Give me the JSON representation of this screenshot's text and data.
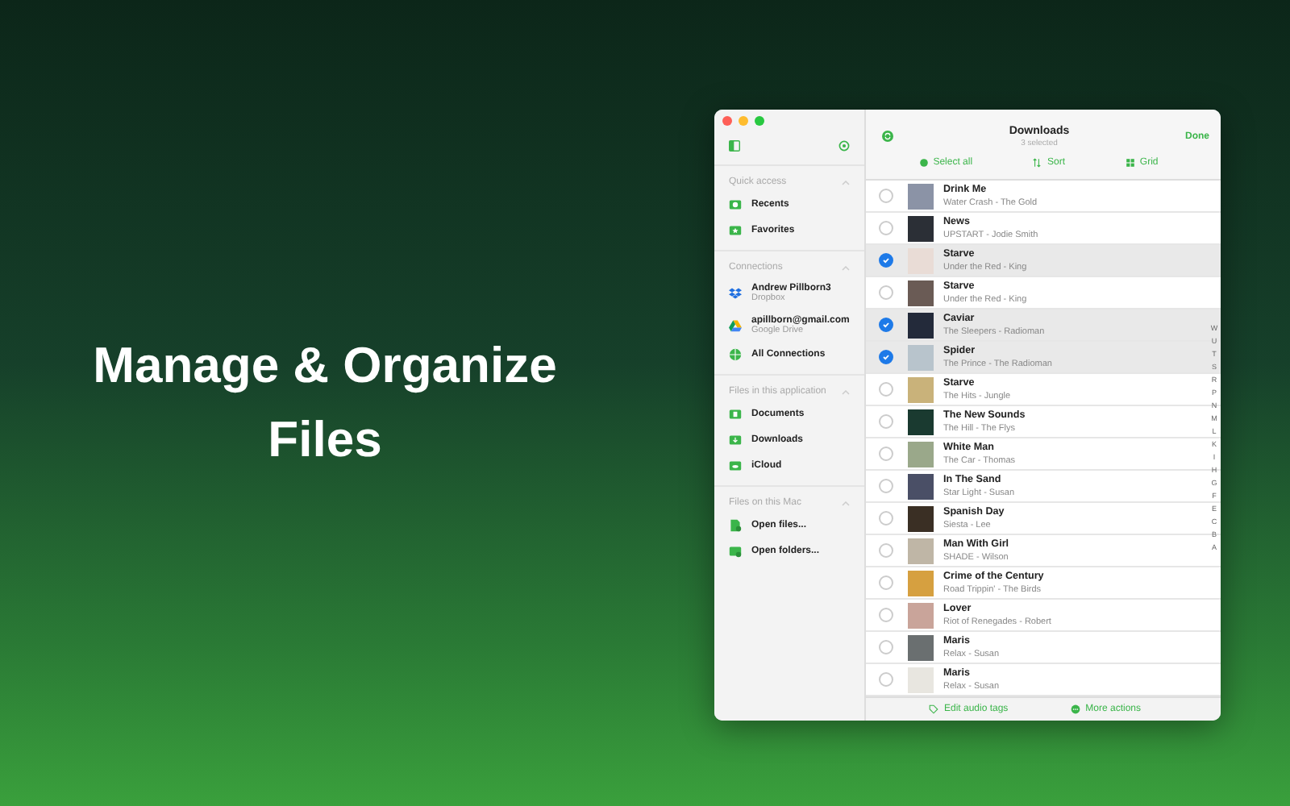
{
  "headline": "Manage & Organize Files",
  "sidebar": {
    "sections": [
      {
        "title": "Quick access",
        "items": [
          {
            "label": "Recents",
            "kind": "clock"
          },
          {
            "label": "Favorites",
            "kind": "star"
          }
        ]
      },
      {
        "title": "Connections",
        "items": [
          {
            "label": "Andrew Pillborn3",
            "sublabel": "Dropbox",
            "kind": "dropbox"
          },
          {
            "label": "apillborn@gmail.com",
            "sublabel": "Google Drive",
            "kind": "drive"
          },
          {
            "label": "All Connections",
            "kind": "globe"
          }
        ]
      },
      {
        "title": "Files in this application",
        "items": [
          {
            "label": "Documents",
            "kind": "doc"
          },
          {
            "label": "Downloads",
            "kind": "download"
          },
          {
            "label": "iCloud",
            "kind": "cloud"
          }
        ]
      },
      {
        "title": "Files on this Mac",
        "items": [
          {
            "label": "Open files...",
            "kind": "file"
          },
          {
            "label": "Open folders...",
            "kind": "folders"
          }
        ]
      }
    ]
  },
  "header": {
    "title": "Downloads",
    "subtitle": "3 selected",
    "done": "Done"
  },
  "toolbar": [
    {
      "label": "Select all",
      "kind": "select"
    },
    {
      "label": "Sort",
      "kind": "sort"
    },
    {
      "label": "Grid",
      "kind": "grid"
    }
  ],
  "tracks": [
    {
      "title": "Drink Me",
      "subtitle": "Water Crash - The Gold",
      "selected": false
    },
    {
      "title": "News",
      "subtitle": "UPSTART - Jodie Smith",
      "selected": false
    },
    {
      "title": "Starve",
      "subtitle": "Under the Red - King",
      "selected": true
    },
    {
      "title": "Starve",
      "subtitle": "Under the Red - King",
      "selected": false
    },
    {
      "title": "Caviar",
      "subtitle": "The Sleepers - Radioman",
      "selected": true
    },
    {
      "title": "Spider",
      "subtitle": "The Prince - The Radioman",
      "selected": true
    },
    {
      "title": "Starve",
      "subtitle": "The Hits - Jungle",
      "selected": false
    },
    {
      "title": "The New Sounds",
      "subtitle": "The Hill - The Flys",
      "selected": false
    },
    {
      "title": "White Man",
      "subtitle": "The Car - Thomas",
      "selected": false
    },
    {
      "title": "In The Sand",
      "subtitle": "Star Light - Susan",
      "selected": false
    },
    {
      "title": "Spanish Day",
      "subtitle": "Siesta - Lee",
      "selected": false
    },
    {
      "title": "Man With Girl",
      "subtitle": "SHADE - Wilson",
      "selected": false
    },
    {
      "title": "Crime of the Century",
      "subtitle": "Road Trippin' - The Birds",
      "selected": false
    },
    {
      "title": "Lover",
      "subtitle": "Riot of Renegades - Robert",
      "selected": false
    },
    {
      "title": "Maris",
      "subtitle": "Relax - Susan",
      "selected": false
    },
    {
      "title": "Maris",
      "subtitle": "Relax - Susan",
      "selected": false
    }
  ],
  "index": [
    "W",
    "U",
    "T",
    "S",
    "R",
    "P",
    "N",
    "M",
    "L",
    "K",
    "I",
    "H",
    "G",
    "F",
    "E",
    "C",
    "B",
    "A"
  ],
  "footer": [
    {
      "label": "Edit audio tags",
      "kind": "tag"
    },
    {
      "label": "More actions",
      "kind": "more"
    }
  ]
}
